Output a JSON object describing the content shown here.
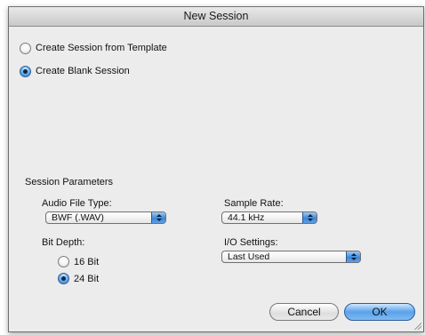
{
  "window": {
    "title": "New Session"
  },
  "options": {
    "from_template": {
      "label": "Create Session from Template",
      "selected": false
    },
    "blank_session": {
      "label": "Create Blank Session",
      "selected": true
    }
  },
  "params": {
    "heading": "Session Parameters",
    "audio_file_type": {
      "label": "Audio File Type:",
      "value": "BWF (.WAV)"
    },
    "sample_rate": {
      "label": "Sample Rate:",
      "value": "44.1 kHz"
    },
    "bit_depth": {
      "label": "Bit Depth:",
      "options": [
        {
          "label": "16 Bit",
          "selected": false
        },
        {
          "label": "24 Bit",
          "selected": true
        }
      ]
    },
    "io_settings": {
      "label": "I/O Settings:",
      "value": "Last Used"
    }
  },
  "buttons": {
    "cancel": "Cancel",
    "ok": "OK"
  },
  "colors": {
    "accent": "#4a93e0",
    "window_bg": "#ececec"
  }
}
